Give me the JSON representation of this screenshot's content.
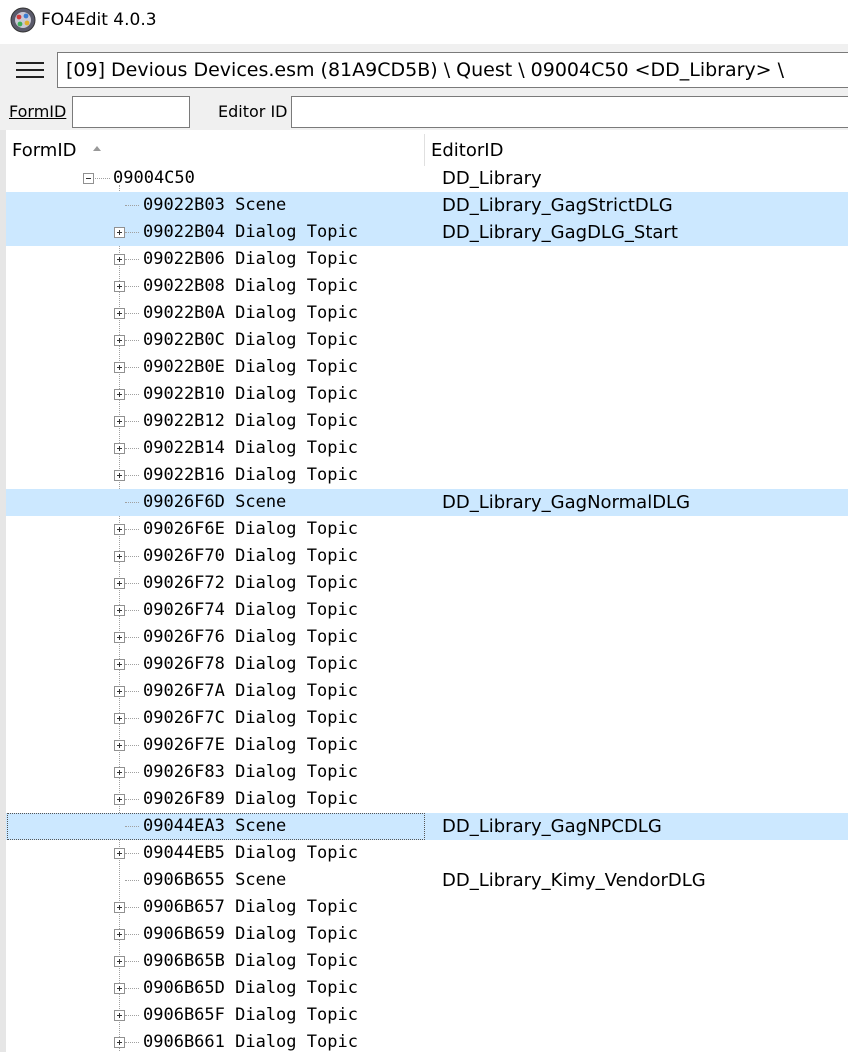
{
  "window": {
    "title": "FO4Edit 4.0.3"
  },
  "path_bar": {
    "text": "[09] Devious Devices.esm (81A9CD5B) \\ Quest \\ 09004C50 <DD_Library> \\"
  },
  "filter": {
    "formid_label": "FormID",
    "formid_value": "",
    "editorid_label": "Editor ID",
    "editorid_value": ""
  },
  "columns": {
    "formid": "FormID",
    "editorid": "EditorID"
  },
  "root": {
    "formid": "09004C50",
    "editorid": "DD_Library",
    "expander": "minus"
  },
  "rows": [
    {
      "formid": "09022B03",
      "type": "Scene",
      "editorid": "DD_Library_GagStrictDLG",
      "expander": "none",
      "selected": true,
      "focused": false
    },
    {
      "formid": "09022B04",
      "type": "Dialog Topic",
      "editorid": "DD_Library_GagDLG_Start",
      "expander": "plus",
      "selected": true,
      "focused": false
    },
    {
      "formid": "09022B06",
      "type": "Dialog Topic",
      "editorid": "",
      "expander": "plus",
      "selected": false,
      "focused": false
    },
    {
      "formid": "09022B08",
      "type": "Dialog Topic",
      "editorid": "",
      "expander": "plus",
      "selected": false,
      "focused": false
    },
    {
      "formid": "09022B0A",
      "type": "Dialog Topic",
      "editorid": "",
      "expander": "plus",
      "selected": false,
      "focused": false
    },
    {
      "formid": "09022B0C",
      "type": "Dialog Topic",
      "editorid": "",
      "expander": "plus",
      "selected": false,
      "focused": false
    },
    {
      "formid": "09022B0E",
      "type": "Dialog Topic",
      "editorid": "",
      "expander": "plus",
      "selected": false,
      "focused": false
    },
    {
      "formid": "09022B10",
      "type": "Dialog Topic",
      "editorid": "",
      "expander": "plus",
      "selected": false,
      "focused": false
    },
    {
      "formid": "09022B12",
      "type": "Dialog Topic",
      "editorid": "",
      "expander": "plus",
      "selected": false,
      "focused": false
    },
    {
      "formid": "09022B14",
      "type": "Dialog Topic",
      "editorid": "",
      "expander": "plus",
      "selected": false,
      "focused": false
    },
    {
      "formid": "09022B16",
      "type": "Dialog Topic",
      "editorid": "",
      "expander": "plus",
      "selected": false,
      "focused": false
    },
    {
      "formid": "09026F6D",
      "type": "Scene",
      "editorid": "DD_Library_GagNormalDLG",
      "expander": "none",
      "selected": true,
      "focused": false
    },
    {
      "formid": "09026F6E",
      "type": "Dialog Topic",
      "editorid": "",
      "expander": "plus",
      "selected": false,
      "focused": false
    },
    {
      "formid": "09026F70",
      "type": "Dialog Topic",
      "editorid": "",
      "expander": "plus",
      "selected": false,
      "focused": false
    },
    {
      "formid": "09026F72",
      "type": "Dialog Topic",
      "editorid": "",
      "expander": "plus",
      "selected": false,
      "focused": false
    },
    {
      "formid": "09026F74",
      "type": "Dialog Topic",
      "editorid": "",
      "expander": "plus",
      "selected": false,
      "focused": false
    },
    {
      "formid": "09026F76",
      "type": "Dialog Topic",
      "editorid": "",
      "expander": "plus",
      "selected": false,
      "focused": false
    },
    {
      "formid": "09026F78",
      "type": "Dialog Topic",
      "editorid": "",
      "expander": "plus",
      "selected": false,
      "focused": false
    },
    {
      "formid": "09026F7A",
      "type": "Dialog Topic",
      "editorid": "",
      "expander": "plus",
      "selected": false,
      "focused": false
    },
    {
      "formid": "09026F7C",
      "type": "Dialog Topic",
      "editorid": "",
      "expander": "plus",
      "selected": false,
      "focused": false
    },
    {
      "formid": "09026F7E",
      "type": "Dialog Topic",
      "editorid": "",
      "expander": "plus",
      "selected": false,
      "focused": false
    },
    {
      "formid": "09026F83",
      "type": "Dialog Topic",
      "editorid": "",
      "expander": "plus",
      "selected": false,
      "focused": false
    },
    {
      "formid": "09026F89",
      "type": "Dialog Topic",
      "editorid": "",
      "expander": "plus",
      "selected": false,
      "focused": false
    },
    {
      "formid": "09044EA3",
      "type": "Scene",
      "editorid": "DD_Library_GagNPCDLG",
      "expander": "none",
      "selected": true,
      "focused": true
    },
    {
      "formid": "09044EB5",
      "type": "Dialog Topic",
      "editorid": "",
      "expander": "plus",
      "selected": false,
      "focused": false
    },
    {
      "formid": "0906B655",
      "type": "Scene",
      "editorid": "DD_Library_Kimy_VendorDLG",
      "expander": "none",
      "selected": false,
      "focused": false
    },
    {
      "formid": "0906B657",
      "type": "Dialog Topic",
      "editorid": "",
      "expander": "plus",
      "selected": false,
      "focused": false
    },
    {
      "formid": "0906B659",
      "type": "Dialog Topic",
      "editorid": "",
      "expander": "plus",
      "selected": false,
      "focused": false
    },
    {
      "formid": "0906B65B",
      "type": "Dialog Topic",
      "editorid": "",
      "expander": "plus",
      "selected": false,
      "focused": false
    },
    {
      "formid": "0906B65D",
      "type": "Dialog Topic",
      "editorid": "",
      "expander": "plus",
      "selected": false,
      "focused": false
    },
    {
      "formid": "0906B65F",
      "type": "Dialog Topic",
      "editorid": "",
      "expander": "plus",
      "selected": false,
      "focused": false
    },
    {
      "formid": "0906B661",
      "type": "Dialog Topic",
      "editorid": "",
      "expander": "plus",
      "selected": false,
      "focused": false
    }
  ],
  "icons": {
    "app": "fo4edit-icon",
    "menu": "hamburger-menu-icon",
    "sort": "sort-ascending-icon",
    "expand": "expand-plus-icon",
    "collapse": "collapse-minus-icon"
  },
  "colors": {
    "selection": "#cce8ff",
    "toolbar": "#f0f0f0"
  }
}
